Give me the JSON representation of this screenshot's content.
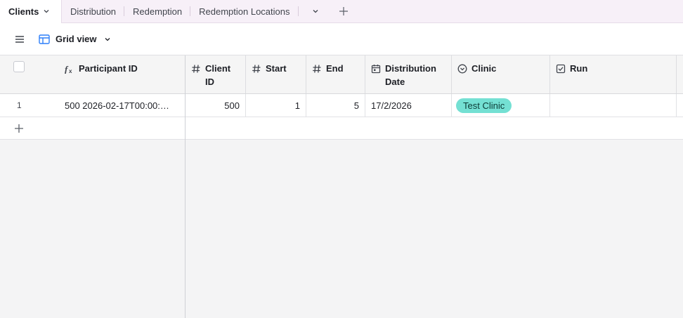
{
  "tabs": [
    {
      "label": "Clients",
      "active": true
    },
    {
      "label": "Distribution"
    },
    {
      "label": "Redemption"
    },
    {
      "label": "Redemption Locations"
    }
  ],
  "toolbar": {
    "view_label": "Grid view"
  },
  "columns": [
    {
      "label": "Participant ID",
      "icon": "formula-icon"
    },
    {
      "label": "Client ID",
      "icon": "number-icon"
    },
    {
      "label": "Start",
      "icon": "number-icon"
    },
    {
      "label": "End",
      "icon": "number-icon"
    },
    {
      "label": "Distribution Date",
      "icon": "calendar-icon"
    },
    {
      "label": "Clinic",
      "icon": "single-select-icon"
    },
    {
      "label": "Run",
      "icon": "checkbox-icon"
    }
  ],
  "rows": [
    {
      "row_number": "1",
      "participant_id": "500 2026-02-17T00:00:…",
      "client_id": "500",
      "start": "1",
      "end": "5",
      "distribution_date": "17/2/2026",
      "clinic": "Test Clinic",
      "run": ""
    }
  ],
  "colors": {
    "tabbar_bg": "#f7f0f8",
    "clinic_pill": "#74e0d3",
    "grid_bg": "#f4f4f5"
  }
}
